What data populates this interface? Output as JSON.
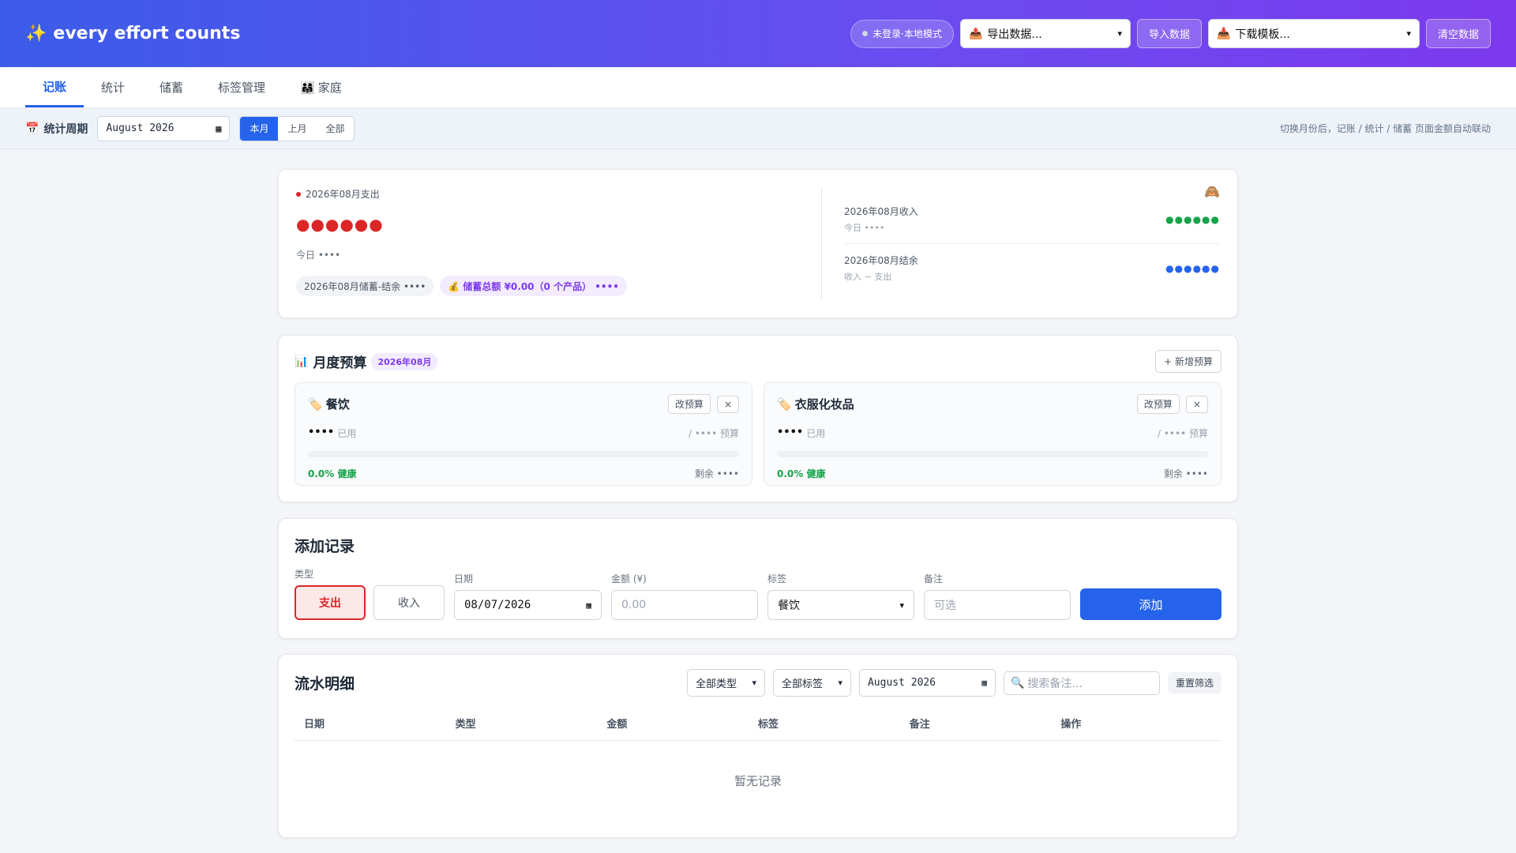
{
  "header": {
    "brand_icon": "sparkles-icon",
    "brand": "every effort counts",
    "status": "未登录·本地模式",
    "export_select": "导出数据...",
    "import_button": "导入数据",
    "template_select": "下载模板...",
    "clear_button": "清空数据"
  },
  "tabs": [
    {
      "label": "记账"
    },
    {
      "label": "统计"
    },
    {
      "label": "储蓄"
    },
    {
      "label": "标签管理"
    },
    {
      "label": "家庭",
      "icon": "family-icon"
    }
  ],
  "period": {
    "label": "统计周期",
    "month_value": "August 2026",
    "seg": [
      "本月",
      "上月",
      "全部"
    ],
    "hint": "切换月份后，记账 / 统计 / 储蓄 页面金额自动联动"
  },
  "summary": {
    "expense_title": "2026年08月支出",
    "expense_value": "●●●●●●",
    "today": "今日 ••••",
    "chip_saving_net": "2026年08月储蓄-结余 ••••",
    "chip_saving_total": "💰 储蓄总额 ¥0.00（0 个产品） ••••",
    "income_title": "2026年08月收入",
    "income_sub": "今日 ••••",
    "income_value": "●●●●●●",
    "balance_title": "2026年08月结余",
    "balance_sub": "收入 − 支出",
    "balance_value": "●●●●●●",
    "colors": {
      "expense": "#dc2626",
      "income": "#16a34a",
      "balance": "#2563eb"
    }
  },
  "budget": {
    "title": "月度预算",
    "badge": "2026年08月",
    "add_button": "+ 新增预算",
    "items": [
      {
        "name": "餐饮",
        "edit": "改预算",
        "close": "×",
        "used": "••••",
        "used_label": "已用",
        "budget": "/ •••• 预算",
        "pct": "0.0% 健康",
        "remain": "剩余 ••••",
        "progress": 0
      },
      {
        "name": "衣服化妆品",
        "edit": "改预算",
        "close": "×",
        "used": "••••",
        "used_label": "已用",
        "budget": "/ •••• 预算",
        "pct": "0.0% 健康",
        "remain": "剩余 ••••",
        "progress": 0
      }
    ]
  },
  "add": {
    "title": "添加记录",
    "type_label": "类型",
    "type_expense": "支出",
    "type_income": "收入",
    "date_label": "日期",
    "date_value": "08/07/2026",
    "amount_label": "金额 (¥)",
    "amount_placeholder": "0.00",
    "tag_label": "标签",
    "tag_value": "餐饮",
    "note_label": "备注",
    "note_placeholder": "可选",
    "submit": "添加"
  },
  "ledger": {
    "title": "流水明细",
    "type_filter": "全部类型",
    "tag_filter": "全部标签",
    "month_value": "August 2026",
    "search_placeholder": "搜索备注...",
    "reset": "重置筛选",
    "columns": [
      "日期",
      "类型",
      "金额",
      "标签",
      "备注",
      "操作"
    ],
    "empty": "暂无记录"
  }
}
